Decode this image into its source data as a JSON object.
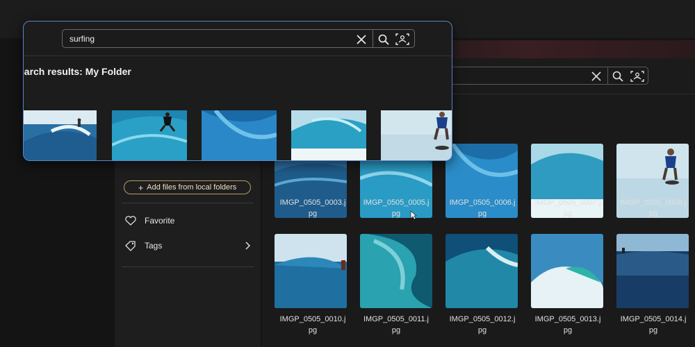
{
  "popup": {
    "search_query": "surfing",
    "results_title": "earch results: My Folder"
  },
  "background_search": {
    "query": ""
  },
  "sidebar": {
    "add_files_label": "Add files from local folders",
    "items": [
      {
        "label": "Favorite",
        "icon": "heart-icon"
      },
      {
        "label": "Tags",
        "icon": "tag-icon"
      }
    ]
  },
  "grid": {
    "row1": [
      {
        "name": "IMGP_0505_0003.j\npg"
      },
      {
        "name": "IMGP_0505_0005.j\npg"
      },
      {
        "name": "IMGP_0505_0006.j\npg"
      },
      {
        "name": "IMGP_0505_0007.j\npg"
      },
      {
        "name": "IMGP_0505_0008.j\npg"
      }
    ],
    "row2": [
      {
        "name": "IMGP_0505_0010.j\npg"
      },
      {
        "name": "IMGP_0505_0011.j\npg"
      },
      {
        "name": "IMGP_0505_0012.j\npg"
      },
      {
        "name": "IMGP_0505_0013.j\npg"
      },
      {
        "name": "IMGP_0505_0014.j\npg"
      }
    ]
  },
  "colors": {
    "popup_border": "#5a86c8",
    "add_button_border": "#b89c62",
    "background": "#141414"
  }
}
